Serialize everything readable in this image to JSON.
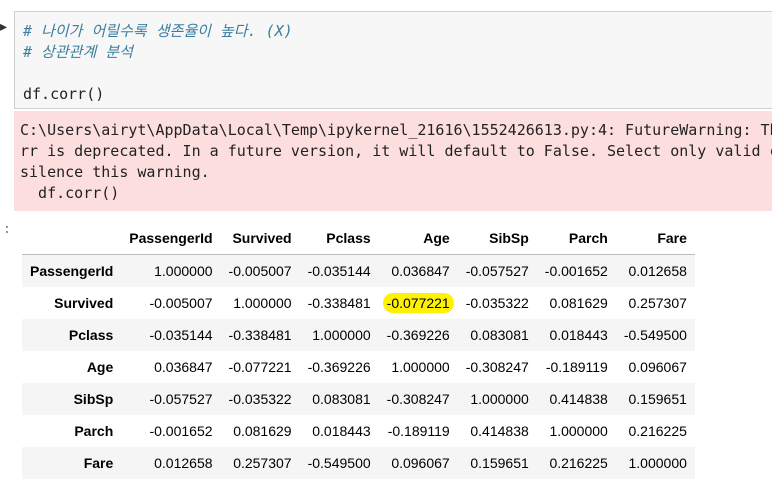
{
  "input_cell": {
    "comment_1": "# 나이가 어릴수록 생존율이 높다. (X)",
    "comment_2": "# 상관관계 분석",
    "code": "df.corr()"
  },
  "stderr": {
    "line_1": "C:\\Users\\airyt\\AppData\\Local\\Temp\\ipykernel_21616\\1552426613.py:4: FutureWarning: Th",
    "line_2": "rr is deprecated. In a future version, it will default to False. Select only valid c",
    "line_3": "silence this warning.",
    "line_4": "  df.corr()"
  },
  "output_prompt": ":",
  "table": {
    "columns": [
      "PassengerId",
      "Survived",
      "Pclass",
      "Age",
      "SibSp",
      "Parch",
      "Fare"
    ],
    "rows": [
      {
        "label": "PassengerId",
        "values": [
          "1.000000",
          "-0.005007",
          "-0.035144",
          "0.036847",
          "-0.057527",
          "-0.001652",
          "0.012658"
        ]
      },
      {
        "label": "Survived",
        "values": [
          "-0.005007",
          "1.000000",
          "-0.338481",
          "-0.077221",
          "-0.035322",
          "0.081629",
          "0.257307"
        ]
      },
      {
        "label": "Pclass",
        "values": [
          "-0.035144",
          "-0.338481",
          "1.000000",
          "-0.369226",
          "0.083081",
          "0.018443",
          "-0.549500"
        ]
      },
      {
        "label": "Age",
        "values": [
          "0.036847",
          "-0.077221",
          "-0.369226",
          "1.000000",
          "-0.308247",
          "-0.189119",
          "0.096067"
        ]
      },
      {
        "label": "SibSp",
        "values": [
          "-0.057527",
          "-0.035322",
          "0.083081",
          "-0.308247",
          "1.000000",
          "0.414838",
          "0.159651"
        ]
      },
      {
        "label": "Parch",
        "values": [
          "-0.001652",
          "0.081629",
          "0.018443",
          "-0.189119",
          "0.414838",
          "1.000000",
          "0.216225"
        ]
      },
      {
        "label": "Fare",
        "values": [
          "0.012658",
          "0.257307",
          "-0.549500",
          "0.096067",
          "0.159651",
          "0.216225",
          "1.000000"
        ]
      }
    ],
    "highlight": {
      "row": 1,
      "col": 3,
      "color": "#fff200"
    }
  },
  "colors": {
    "comment": "#3a7fa0",
    "stderr_background": "#fddede",
    "input_background": "#f7f7f7",
    "highlight": "#fff200"
  }
}
